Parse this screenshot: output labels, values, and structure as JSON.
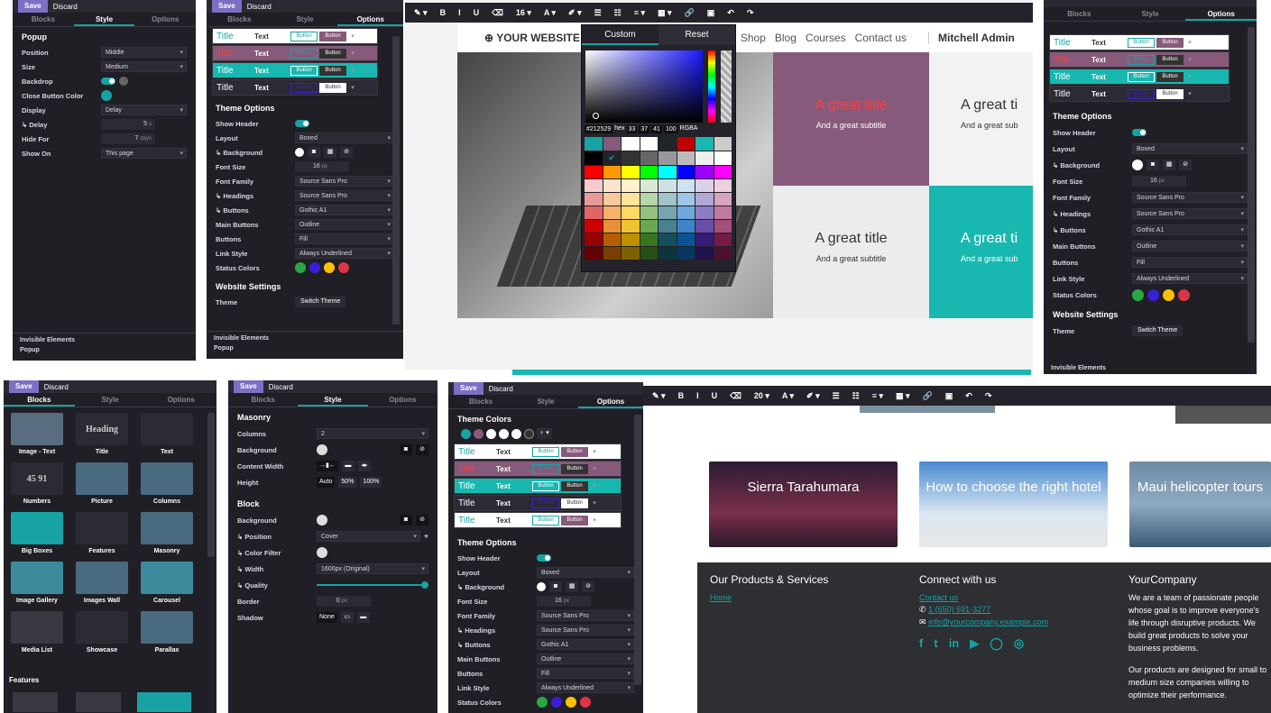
{
  "common": {
    "save": "Save",
    "discard": "Discard",
    "tab_blocks": "Blocks",
    "tab_style": "Style",
    "tab_options": "Options"
  },
  "popup_panel": {
    "title": "Popup",
    "rows": [
      {
        "label": "Position",
        "value": "Middle"
      },
      {
        "label": "Size",
        "value": "Medium"
      },
      {
        "label": "Backdrop",
        "value": ""
      },
      {
        "label": "Close Button Color",
        "value": ""
      },
      {
        "label": "Display",
        "value": "Delay"
      },
      {
        "label": "↳ Delay",
        "value": "5",
        "unit": "s"
      },
      {
        "label": "Hide For",
        "value": "7",
        "unit": "days"
      },
      {
        "label": "Show On",
        "value": "This page"
      }
    ],
    "footer": [
      "Invisible Elements",
      "Popup"
    ]
  },
  "theme_panel": {
    "swatch_rows": [
      {
        "title": "Title",
        "text": "Text",
        "btn1": "Button",
        "btn2": "Button"
      },
      {
        "title": "Title",
        "text": "Text",
        "btn1": "Button",
        "btn2": "Button"
      },
      {
        "title": "Title",
        "text": "Text",
        "btn1": "Button",
        "btn2": "Button"
      },
      {
        "title": "Title",
        "text": "Text",
        "btn1": "Button",
        "btn2": "Button"
      },
      {
        "title": "Title",
        "text": "Text",
        "btn1": "Button",
        "btn2": "Button"
      }
    ],
    "theme_options": "Theme Options",
    "show_header": "Show Header",
    "layout": {
      "label": "Layout",
      "value": "Boxed"
    },
    "background": "↳ Background",
    "font_size": {
      "label": "Font Size",
      "value": "16",
      "unit": "px"
    },
    "font_family": {
      "label": "Font Family",
      "value": "Source Sans Pro"
    },
    "headings": {
      "label": "↳ Headings",
      "value": "Source Sans Pro"
    },
    "buttons_font": {
      "label": "↳ Buttons",
      "value": "Gothic A1"
    },
    "main_buttons": {
      "label": "Main Buttons",
      "value": "Outline"
    },
    "buttons": {
      "label": "Buttons",
      "value": "Fill"
    },
    "link_style": {
      "label": "Link Style",
      "value": "Always Underlined"
    },
    "status_colors": "Status Colors",
    "website_settings": "Website Settings",
    "theme": {
      "label": "Theme",
      "value": "Switch Theme"
    },
    "footer": [
      "Invisible Elements",
      "Popup"
    ],
    "footer_right": [
      "Invisible Elements"
    ]
  },
  "editor": {
    "toolbar": [
      "✎ ▾",
      "B",
      "I",
      "U",
      "⌫",
      "16 ▾",
      "A ▾",
      "✐ ▾",
      "☰",
      "☷",
      "≡ ▾",
      "▦ ▾",
      "🔗",
      "▣",
      "↶",
      "↷"
    ],
    "toolbar2": [
      "✎ ▾",
      "B",
      "I",
      "U",
      "⌫",
      "20 ▾",
      "A ▾",
      "✐ ▾",
      "☰",
      "☷",
      "≡ ▾",
      "▦ ▾",
      "🔗",
      "▣",
      "↶",
      "↷"
    ],
    "site_name": "YOUR WEBSITE",
    "nav": [
      "Shop",
      "Blog",
      "Courses",
      "Contact us"
    ],
    "user": "Mitchell Admin",
    "picker_tabs": [
      "Custom",
      "Reset"
    ],
    "picker_inputs": {
      "hex_value": "#212529",
      "hex": "hex",
      "r": "33",
      "g": "37",
      "b": "41",
      "a": "100",
      "rgba": "RGBA"
    },
    "great_title": "A great title",
    "great_title_cut": "A great ti",
    "subtitle": "And a great subtitle",
    "subtitle_cut": "And a great sub"
  },
  "blocks_panel": {
    "items": [
      "Image - Text",
      "Title",
      "Text",
      "Numbers",
      "Picture",
      "Columns",
      "Big Boxes",
      "Features",
      "Masonry",
      "Image Gallery",
      "Images Wall",
      "Carousel",
      "Media List",
      "Showcase",
      "Parallax"
    ],
    "heading_label": "Heading",
    "numbers_label": "45 91",
    "section": "Features"
  },
  "masonry_panel": {
    "title": "Masonry",
    "rows": [
      {
        "label": "Columns",
        "value": "2"
      },
      {
        "label": "Background",
        "value": ""
      },
      {
        "label": "Content Width",
        "value": ""
      },
      {
        "label": "Height",
        "value": ""
      }
    ],
    "height_opts": [
      "Auto",
      "50%",
      "100%"
    ],
    "block_title": "Block",
    "block_rows": [
      {
        "label": "Background",
        "value": ""
      },
      {
        "label": "↳ Position",
        "value": "Cover"
      },
      {
        "label": "↳ Color Filter",
        "value": ""
      },
      {
        "label": "↳ Width",
        "value": "1600px (Original)"
      },
      {
        "label": "↳ Quality",
        "value": ""
      },
      {
        "label": "Border",
        "value": "0",
        "unit": "px"
      },
      {
        "label": "Shadow",
        "value": "None"
      }
    ]
  },
  "theme_colors_panel": {
    "title": "Theme Colors",
    "theme_options": "Theme Options",
    "status_colors": "Status Colors"
  },
  "footer_site": {
    "cards": [
      "Sierra Tarahumara",
      "How to choose the right hotel",
      "Maui helicopter tours"
    ],
    "col1_title": "Our Products & Services",
    "col1_link": "Home",
    "col2_title": "Connect with us",
    "contact": "Contact us",
    "phone": "1 (650) 691-3277",
    "email": "info@yourcompany.example.com",
    "col3_title": "YourCompany",
    "about1": "We are a team of passionate people whose goal is to improve everyone's life through disruptive products. We build great products to solve your business problems.",
    "about2": "Our products are designed for small to medium size companies willing to optimize their performance."
  }
}
